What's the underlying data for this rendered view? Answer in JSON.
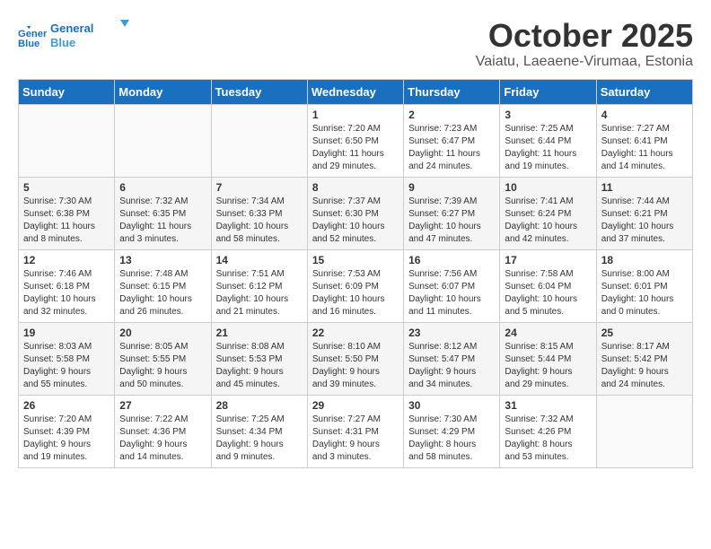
{
  "logo": {
    "line1": "General",
    "line2": "Blue"
  },
  "title": "October 2025",
  "subtitle": "Vaiatu, Laeaene-Virumaa, Estonia",
  "days_header": [
    "Sunday",
    "Monday",
    "Tuesday",
    "Wednesday",
    "Thursday",
    "Friday",
    "Saturday"
  ],
  "weeks": [
    [
      {
        "day": "",
        "content": ""
      },
      {
        "day": "",
        "content": ""
      },
      {
        "day": "",
        "content": ""
      },
      {
        "day": "1",
        "content": "Sunrise: 7:20 AM\nSunset: 6:50 PM\nDaylight: 11 hours\nand 29 minutes."
      },
      {
        "day": "2",
        "content": "Sunrise: 7:23 AM\nSunset: 6:47 PM\nDaylight: 11 hours\nand 24 minutes."
      },
      {
        "day": "3",
        "content": "Sunrise: 7:25 AM\nSunset: 6:44 PM\nDaylight: 11 hours\nand 19 minutes."
      },
      {
        "day": "4",
        "content": "Sunrise: 7:27 AM\nSunset: 6:41 PM\nDaylight: 11 hours\nand 14 minutes."
      }
    ],
    [
      {
        "day": "5",
        "content": "Sunrise: 7:30 AM\nSunset: 6:38 PM\nDaylight: 11 hours\nand 8 minutes."
      },
      {
        "day": "6",
        "content": "Sunrise: 7:32 AM\nSunset: 6:35 PM\nDaylight: 11 hours\nand 3 minutes."
      },
      {
        "day": "7",
        "content": "Sunrise: 7:34 AM\nSunset: 6:33 PM\nDaylight: 10 hours\nand 58 minutes."
      },
      {
        "day": "8",
        "content": "Sunrise: 7:37 AM\nSunset: 6:30 PM\nDaylight: 10 hours\nand 52 minutes."
      },
      {
        "day": "9",
        "content": "Sunrise: 7:39 AM\nSunset: 6:27 PM\nDaylight: 10 hours\nand 47 minutes."
      },
      {
        "day": "10",
        "content": "Sunrise: 7:41 AM\nSunset: 6:24 PM\nDaylight: 10 hours\nand 42 minutes."
      },
      {
        "day": "11",
        "content": "Sunrise: 7:44 AM\nSunset: 6:21 PM\nDaylight: 10 hours\nand 37 minutes."
      }
    ],
    [
      {
        "day": "12",
        "content": "Sunrise: 7:46 AM\nSunset: 6:18 PM\nDaylight: 10 hours\nand 32 minutes."
      },
      {
        "day": "13",
        "content": "Sunrise: 7:48 AM\nSunset: 6:15 PM\nDaylight: 10 hours\nand 26 minutes."
      },
      {
        "day": "14",
        "content": "Sunrise: 7:51 AM\nSunset: 6:12 PM\nDaylight: 10 hours\nand 21 minutes."
      },
      {
        "day": "15",
        "content": "Sunrise: 7:53 AM\nSunset: 6:09 PM\nDaylight: 10 hours\nand 16 minutes."
      },
      {
        "day": "16",
        "content": "Sunrise: 7:56 AM\nSunset: 6:07 PM\nDaylight: 10 hours\nand 11 minutes."
      },
      {
        "day": "17",
        "content": "Sunrise: 7:58 AM\nSunset: 6:04 PM\nDaylight: 10 hours\nand 5 minutes."
      },
      {
        "day": "18",
        "content": "Sunrise: 8:00 AM\nSunset: 6:01 PM\nDaylight: 10 hours\nand 0 minutes."
      }
    ],
    [
      {
        "day": "19",
        "content": "Sunrise: 8:03 AM\nSunset: 5:58 PM\nDaylight: 9 hours\nand 55 minutes."
      },
      {
        "day": "20",
        "content": "Sunrise: 8:05 AM\nSunset: 5:55 PM\nDaylight: 9 hours\nand 50 minutes."
      },
      {
        "day": "21",
        "content": "Sunrise: 8:08 AM\nSunset: 5:53 PM\nDaylight: 9 hours\nand 45 minutes."
      },
      {
        "day": "22",
        "content": "Sunrise: 8:10 AM\nSunset: 5:50 PM\nDaylight: 9 hours\nand 39 minutes."
      },
      {
        "day": "23",
        "content": "Sunrise: 8:12 AM\nSunset: 5:47 PM\nDaylight: 9 hours\nand 34 minutes."
      },
      {
        "day": "24",
        "content": "Sunrise: 8:15 AM\nSunset: 5:44 PM\nDaylight: 9 hours\nand 29 minutes."
      },
      {
        "day": "25",
        "content": "Sunrise: 8:17 AM\nSunset: 5:42 PM\nDaylight: 9 hours\nand 24 minutes."
      }
    ],
    [
      {
        "day": "26",
        "content": "Sunrise: 7:20 AM\nSunset: 4:39 PM\nDaylight: 9 hours\nand 19 minutes."
      },
      {
        "day": "27",
        "content": "Sunrise: 7:22 AM\nSunset: 4:36 PM\nDaylight: 9 hours\nand 14 minutes."
      },
      {
        "day": "28",
        "content": "Sunrise: 7:25 AM\nSunset: 4:34 PM\nDaylight: 9 hours\nand 9 minutes."
      },
      {
        "day": "29",
        "content": "Sunrise: 7:27 AM\nSunset: 4:31 PM\nDaylight: 9 hours\nand 3 minutes."
      },
      {
        "day": "30",
        "content": "Sunrise: 7:30 AM\nSunset: 4:29 PM\nDaylight: 8 hours\nand 58 minutes."
      },
      {
        "day": "31",
        "content": "Sunrise: 7:32 AM\nSunset: 4:26 PM\nDaylight: 8 hours\nand 53 minutes."
      },
      {
        "day": "",
        "content": ""
      }
    ]
  ]
}
